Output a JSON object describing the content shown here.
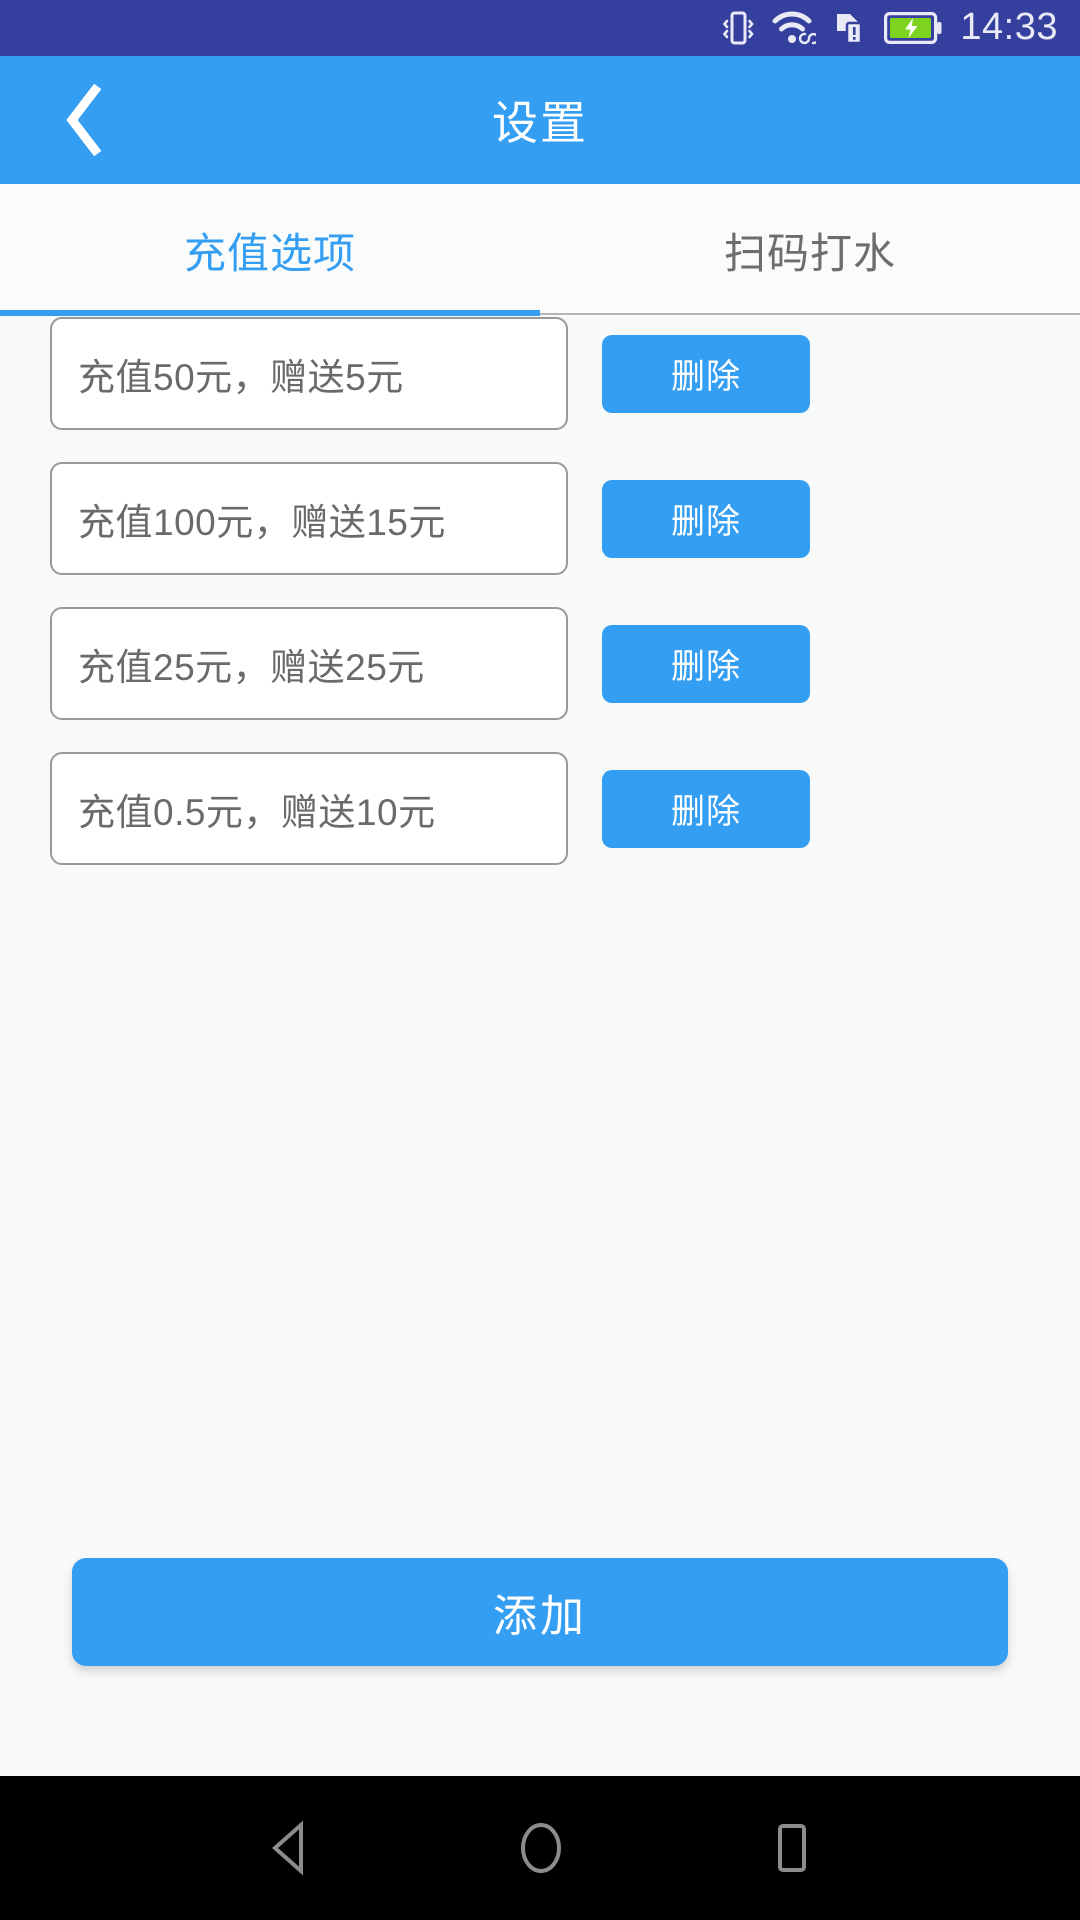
{
  "status_bar": {
    "time": "14:33",
    "background": "#343f9e",
    "icons": [
      {
        "name": "vibrate-icon"
      },
      {
        "name": "wifi-icon"
      },
      {
        "name": "sim-card-alert-icon"
      },
      {
        "name": "battery-charging-icon",
        "color": "#7ed321"
      }
    ]
  },
  "title_bar": {
    "title": "设置",
    "back_icon": "back-chevron-icon",
    "background": "#349ef3"
  },
  "tabs": {
    "active_index": 0,
    "accent": "#349ef3",
    "items": [
      {
        "label": "充值选项"
      },
      {
        "label": "扫码打水"
      }
    ]
  },
  "options": {
    "delete_label": "删除",
    "rows": [
      {
        "text": "充值50元，赠送5元"
      },
      {
        "text": "充值100元，赠送15元"
      },
      {
        "text": "充值25元，赠送25元"
      },
      {
        "text": "充值0.5元，赠送10元"
      }
    ]
  },
  "add_button": {
    "label": "添加",
    "color": "#349ef3"
  },
  "nav_bar": {
    "background": "#000000",
    "buttons": [
      {
        "name": "nav-back-icon"
      },
      {
        "name": "nav-home-icon"
      },
      {
        "name": "nav-recents-icon"
      }
    ]
  }
}
